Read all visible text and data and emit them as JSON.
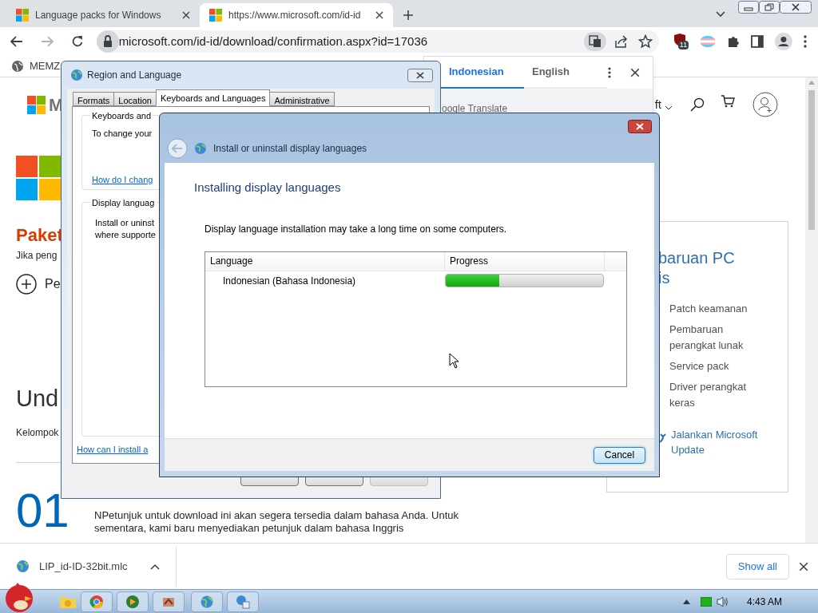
{
  "browser": {
    "tabs": [
      {
        "title": "Language packs for Windows",
        "selected": false
      },
      {
        "title": "https://www.microsoft.com/id-id",
        "selected": true
      }
    ],
    "address": "microsoft.com/id-id/download/confirmation.aspx?id=17036",
    "extension_badge": "11",
    "bookmarks": [
      "MEMZ"
    ]
  },
  "translate_popup": {
    "tabs": [
      {
        "label": "Indonesian",
        "selected": true
      },
      {
        "label": "English",
        "selected": false
      }
    ],
    "caption": "oogle Translate"
  },
  "page": {
    "logo_text": "M",
    "nav_text": "ft",
    "heading": "Paket",
    "intro": "Jika peng",
    "action": "Pe",
    "section_heading": "Und",
    "section_text": "Kelompok",
    "item_number": "01",
    "item_text": "NPetunjuk untuk download ini akan segera tersedia dalam bahasa Anda. Untuk sementara, kami baru menyediakan petunjuk dalam bahasa Inggris",
    "card": {
      "title_lines": [
        "baruan PC",
        "is"
      ],
      "items": [
        "Patch keamanan",
        "Pembaruan perangkat lunak",
        "Service pack",
        "Driver perangkat keras"
      ],
      "link": "Jalankan Microsoft Update"
    }
  },
  "region_dialog": {
    "title": "Region and Language",
    "tabs": [
      {
        "label": "Formats",
        "selected": false
      },
      {
        "label": "Location",
        "selected": false
      },
      {
        "label": "Keyboards and Languages",
        "selected": true
      },
      {
        "label": "Administrative",
        "selected": false
      }
    ],
    "keyboards_group": {
      "label": "Keyboards and",
      "text": "To change your",
      "link": "How do I chang"
    },
    "display_group": {
      "label": "Display languag",
      "text_lines": [
        "Install or uninst",
        "where supporte"
      ]
    },
    "link": "How can I install a",
    "buttons": [
      {
        "disabled": false
      },
      {
        "disabled": false
      },
      {
        "disabled": true
      }
    ]
  },
  "install_dialog": {
    "title": "Install or uninstall display languages",
    "heading": "Installing display languages",
    "note": "Display language installation may take a long time on some computers.",
    "columns": [
      "Language",
      "Progress"
    ],
    "rows": [
      {
        "language": "Indonesian (Bahasa Indonesia)",
        "level": 0.34
      }
    ],
    "buttons": [
      "Cancel"
    ]
  },
  "downloads": {
    "file": "LIP_id-ID-32bit.mlc",
    "show_all": "Show all"
  },
  "taskbar": {
    "clock": "4:43 AM"
  }
}
